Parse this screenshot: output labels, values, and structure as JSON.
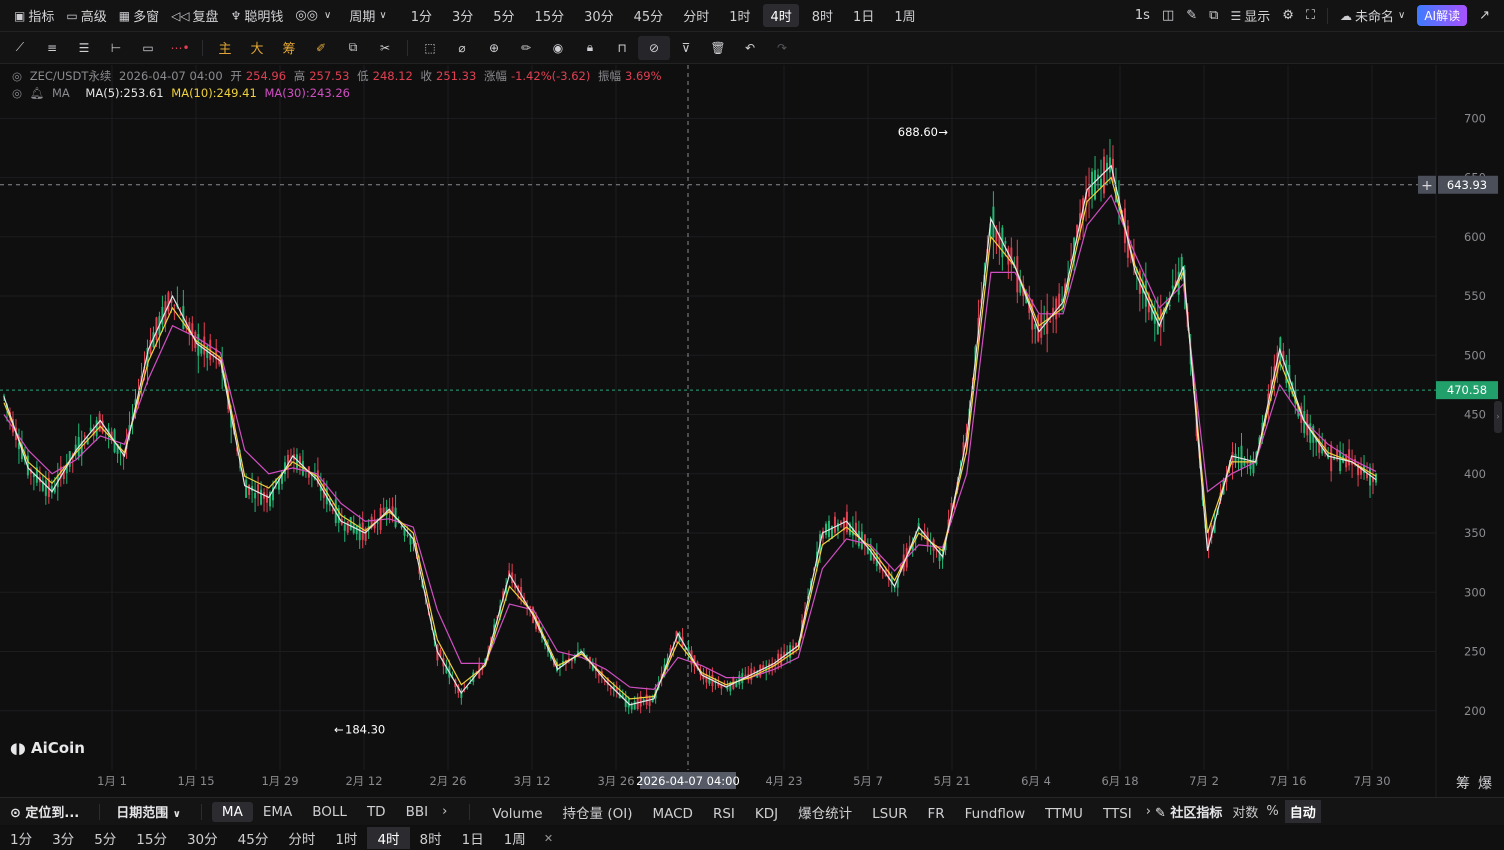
{
  "topbar": {
    "indicators": "指标",
    "advanced": "高级",
    "multi_window": "多窗",
    "replay": "复盘",
    "smart_money": "聪明钱",
    "period_menu": "周期",
    "periods": [
      "1分",
      "3分",
      "5分",
      "15分",
      "30分",
      "45分",
      "分时",
      "1时",
      "4时",
      "8时",
      "1日",
      "1周"
    ],
    "active_period": "4时",
    "refresh": "1s",
    "display": "显示",
    "layout_name": "未命名",
    "ai_button": "AI解读"
  },
  "toolbar": {
    "cn_tools": [
      "主",
      "大",
      "筹"
    ]
  },
  "legend": {
    "symbol": "ZEC/USDT永续",
    "datetime": "2026-04-07 04:00",
    "open_label": "开",
    "open": "254.96",
    "high_label": "高",
    "high": "257.53",
    "low_label": "低",
    "low": "248.12",
    "close_label": "收",
    "close": "251.33",
    "change_label": "涨幅",
    "change": "-1.42%(-3.62)",
    "amp_label": "振幅",
    "amp": "3.69%",
    "ma_label": "MA",
    "ma5": "MA(5):253.61",
    "ma10": "MA(10):249.41",
    "ma30": "MA(30):243.26"
  },
  "chart_data": {
    "type": "line",
    "title": "",
    "xlabel": "",
    "ylabel": "",
    "ylim": [
      150,
      745
    ],
    "y_ticks": [
      200,
      250,
      300,
      350,
      400,
      450,
      500,
      550,
      600,
      650,
      700
    ],
    "x_ticks": [
      "1月 1",
      "1月 15",
      "1月 29",
      "2月 12",
      "2月 26",
      "3月 12",
      "3月 26",
      "4月 23",
      "5月 7",
      "5月 21",
      "6月 4",
      "6月 18",
      "7月 2",
      "7月 16",
      "7月 30"
    ],
    "crosshair_x_label": "2026-04-07 04:00",
    "crosshair_price": "643.93",
    "current_price": "470.58",
    "high_marker": "688.60",
    "low_marker": "184.30",
    "series": [
      {
        "name": "MA(5)",
        "color": "#e6e6e6",
        "x": [
          0,
          4,
          8,
          12,
          16,
          20,
          24,
          28,
          32,
          36,
          40,
          44,
          48,
          52,
          56,
          60,
          64,
          68,
          72,
          76,
          80,
          84,
          88,
          92,
          96,
          100,
          104,
          108,
          112,
          116,
          120,
          124,
          128,
          132,
          136,
          140,
          144,
          148,
          152,
          156,
          160,
          164,
          168,
          172,
          176,
          180,
          184,
          188,
          192,
          196,
          200,
          204,
          208,
          212,
          216,
          220,
          224,
          228
        ],
        "values": [
          465,
          405,
          385,
          420,
          445,
          415,
          505,
          550,
          510,
          495,
          390,
          380,
          415,
          395,
          360,
          350,
          370,
          345,
          250,
          215,
          240,
          315,
          280,
          235,
          250,
          225,
          205,
          210,
          265,
          230,
          220,
          230,
          240,
          255,
          350,
          360,
          335,
          305,
          355,
          330,
          430,
          615,
          575,
          520,
          545,
          640,
          660,
          570,
          525,
          575,
          335,
          415,
          410,
          505,
          445,
          415,
          410,
          395
        ]
      },
      {
        "name": "MA(10)",
        "color": "#f0d23c",
        "x": [
          0,
          4,
          8,
          12,
          16,
          20,
          24,
          28,
          32,
          36,
          40,
          44,
          48,
          52,
          56,
          60,
          64,
          68,
          72,
          76,
          80,
          84,
          88,
          92,
          96,
          100,
          104,
          108,
          112,
          116,
          120,
          124,
          128,
          132,
          136,
          140,
          144,
          148,
          152,
          156,
          160,
          164,
          168,
          172,
          176,
          180,
          184,
          188,
          192,
          196,
          200,
          204,
          208,
          212,
          216,
          220,
          224,
          228
        ],
        "values": [
          460,
          410,
          392,
          418,
          440,
          418,
          495,
          540,
          512,
          498,
          398,
          388,
          410,
          398,
          365,
          352,
          368,
          350,
          260,
          222,
          238,
          305,
          282,
          238,
          248,
          228,
          210,
          212,
          258,
          232,
          222,
          228,
          238,
          252,
          340,
          355,
          338,
          310,
          350,
          335,
          420,
          600,
          575,
          525,
          540,
          630,
          650,
          575,
          530,
          570,
          350,
          410,
          410,
          495,
          445,
          418,
          410,
          398
        ]
      },
      {
        "name": "MA(30)",
        "color": "#d04fc2",
        "x": [
          0,
          4,
          8,
          12,
          16,
          20,
          24,
          28,
          32,
          36,
          40,
          44,
          48,
          52,
          56,
          60,
          64,
          68,
          72,
          76,
          80,
          84,
          88,
          92,
          96,
          100,
          104,
          108,
          112,
          116,
          120,
          124,
          128,
          132,
          136,
          140,
          144,
          148,
          152,
          156,
          160,
          164,
          168,
          172,
          176,
          180,
          184,
          188,
          192,
          196,
          200,
          204,
          208,
          212,
          216,
          220,
          224,
          228
        ],
        "values": [
          450,
          420,
          400,
          412,
          432,
          425,
          480,
          525,
          515,
          502,
          420,
          400,
          405,
          400,
          375,
          360,
          362,
          355,
          285,
          240,
          240,
          290,
          285,
          250,
          245,
          235,
          220,
          218,
          245,
          238,
          228,
          228,
          235,
          245,
          320,
          345,
          340,
          318,
          340,
          338,
          400,
          570,
          570,
          535,
          535,
          610,
          635,
          585,
          540,
          560,
          385,
          400,
          410,
          475,
          445,
          425,
          412,
          402
        ]
      }
    ]
  },
  "indicator_bar": {
    "locate": "定位到...",
    "date_range": "日期范围",
    "main_indicators": [
      "MA",
      "EMA",
      "BOLL",
      "TD",
      "BBI"
    ],
    "active_main": "MA",
    "sub_indicators": [
      "Volume",
      "持仓量 (OI)",
      "MACD",
      "RSI",
      "KDJ",
      "爆仓统计",
      "LSUR",
      "FR",
      "Fundflow",
      "TTMU",
      "TTSI"
    ],
    "community": "社区指标",
    "log": "对数",
    "percent": "%",
    "auto": "自动"
  },
  "right_side": {
    "chips": "筹",
    "liquidation": "爆"
  },
  "logo": "AiCoin",
  "colors": {
    "up": "#22b573",
    "down": "#e04052",
    "bg": "#0f0f10",
    "grid": "#1d1d20"
  }
}
